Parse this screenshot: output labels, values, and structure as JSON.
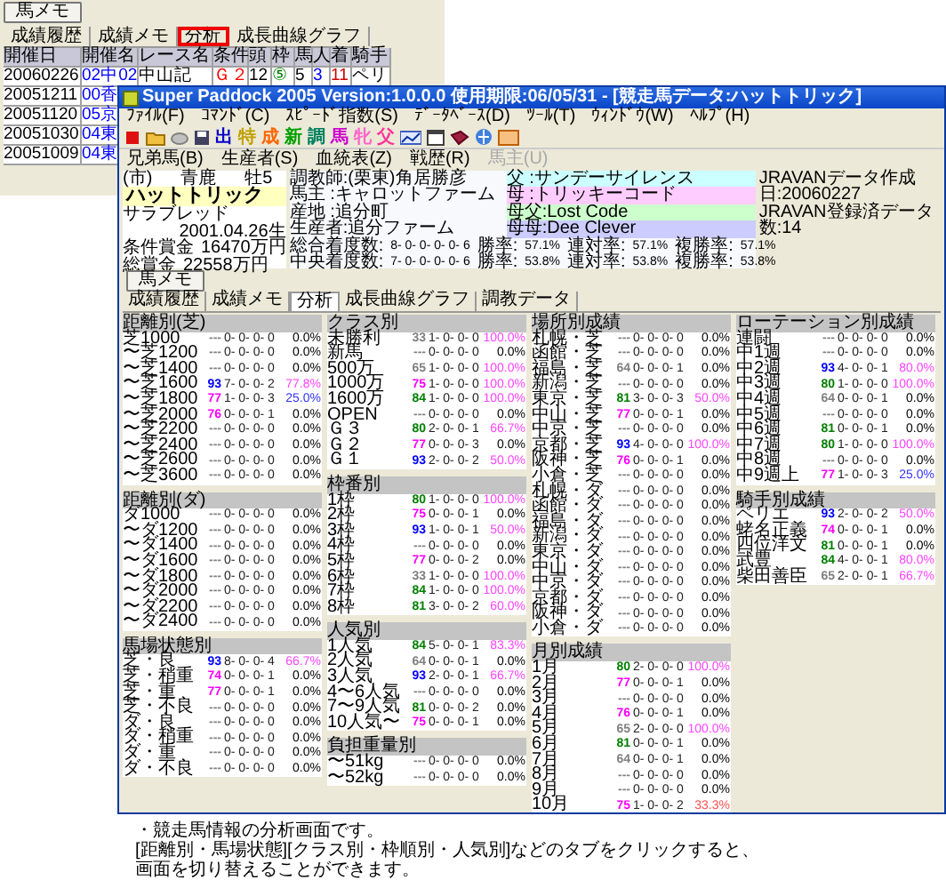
{
  "back_window": {
    "memo_button": "馬メモ",
    "tabs": [
      {
        "label": "成績履歴",
        "selected": false
      },
      {
        "label": "成績メモ",
        "selected": false
      },
      {
        "label": "分析",
        "selected": true
      },
      {
        "label": "成長曲線グラフ",
        "selected": false
      }
    ],
    "columns": [
      "開催日",
      "開催名",
      "レース名",
      "条件",
      "頭",
      "枠",
      "馬",
      "人",
      "着",
      "騎手"
    ],
    "rows": [
      {
        "cells": [
          {
            "text": "20060226"
          },
          {
            "text": "02中02",
            "color": "#0000ff"
          },
          {
            "text": "中山記"
          },
          {
            "text": "Ｇ２",
            "color": "#ff0000"
          },
          {
            "text": "12"
          },
          {
            "text": "⑤",
            "color": "#008000"
          },
          {
            "text": "5"
          },
          {
            "text": "3",
            "color": "#0000ff"
          },
          {
            "text": "11",
            "color": "#cc0000"
          },
          {
            "text": "ペリ"
          }
        ]
      },
      {
        "cells": [
          {
            "text": "20051211"
          },
          {
            "text": "00香",
            "color": "#0000ff"
          }
        ]
      },
      {
        "cells": [
          {
            "text": "20051120"
          },
          {
            "text": "05京",
            "color": "#0000ff"
          }
        ]
      },
      {
        "cells": [
          {
            "text": "20051030"
          },
          {
            "text": "04東",
            "color": "#0000ff"
          }
        ]
      },
      {
        "cells": [
          {
            "text": "20051009"
          },
          {
            "text": "04東",
            "color": "#0000ff"
          }
        ]
      }
    ]
  },
  "window": {
    "title": "Super Paddock 2005 Version:1.0.0.0 使用期限:06/05/31 - [競走馬データ:ハットトリック]",
    "menu": [
      "ﾌｧｲﾙ(F)",
      "ｺﾏﾝﾄﾞ(C)",
      "ｽﾋﾟｰﾄﾞ指数(S)",
      "ﾃﾞｰﾀﾍﾞｰｽ(D)",
      "ﾂｰﾙ(T)",
      "ｳｨﾝﾄﾞｳ(W)",
      "ﾍﾙﾌﾟ(H)"
    ],
    "toolbar_chars": [
      {
        "text": "出",
        "color": "#0000cc"
      },
      {
        "text": "特",
        "color": "#c0a000"
      },
      {
        "text": "成",
        "color": "#ff6600"
      },
      {
        "text": "新",
        "color": "#00a000"
      },
      {
        "text": "調",
        "color": "#008060"
      },
      {
        "text": "馬",
        "color": "#cc00cc"
      },
      {
        "text": "牝",
        "color": "#ff66cc"
      },
      {
        "text": "父",
        "color": "#ff3399"
      }
    ],
    "toolbar2": [
      {
        "label": "兄弟馬(B)",
        "disabled": false
      },
      {
        "label": "生産者(S)",
        "disabled": false
      },
      {
        "label": "血統表(Z)",
        "disabled": false
      },
      {
        "label": "戦歴(R)",
        "disabled": false
      },
      {
        "label": "馬主(U)",
        "disabled": true
      }
    ]
  },
  "horse": {
    "region": "(市)",
    "coat": "青鹿",
    "sex_age": "牡5",
    "name": "ハットトリック",
    "breed": "サラブレッド",
    "birth": "2001.04.26生",
    "prizes": [
      {
        "label": "条件賞金",
        "value": "16470万円"
      },
      {
        "label": "総賞金",
        "value": "22558万円"
      }
    ],
    "details": [
      "調教師:(栗東)角居勝彦",
      "馬主 :キャロットファーム",
      "産地 :追分町",
      "生産者:追分ファーム"
    ],
    "pedigree": [
      {
        "text": "父 :サンデーサイレンス",
        "color": "#ccffff"
      },
      {
        "text": "母 :トリッキーコード",
        "color": "#ffccff"
      },
      {
        "text": "母父:Lost Code",
        "color": "#ccffcc"
      },
      {
        "text": "母母:Dee Clever",
        "color": "#ccccff"
      }
    ],
    "records": [
      {
        "label": "総合着度数:",
        "counts": "8- 0- 0- 0- 0- 6",
        "stats": [
          {
            "label": "勝率:",
            "value": "57.1%"
          },
          {
            "label": "連対率:",
            "value": "57.1%"
          },
          {
            "label": "複勝率:",
            "value": "57.1%"
          }
        ]
      },
      {
        "label": "中央着度数:",
        "counts": "7- 0- 0- 0- 0- 6",
        "stats": [
          {
            "label": "勝率:",
            "value": "53.8%"
          },
          {
            "label": "連対率:",
            "value": "53.8%"
          },
          {
            "label": "複勝率:",
            "value": "53.8%"
          }
        ]
      }
    ],
    "jravan": [
      "JRAVANデータ作成日:20060227",
      "JRAVAN登録済データ数:14"
    ]
  },
  "memo_button": "馬メモ",
  "tabs": [
    {
      "label": "成績履歴",
      "selected": false
    },
    {
      "label": "成績メモ",
      "selected": false
    },
    {
      "label": "分析",
      "selected": true
    },
    {
      "label": "成長曲線グラフ",
      "selected": false
    },
    {
      "label": "調教データ",
      "selected": false
    }
  ],
  "columns": [
    {
      "sections": [
        {
          "title": "距離別(芝)",
          "rows": [
            {
              "label": "芝1000",
              "index": "---",
              "color": "#808080",
              "record": "0- 0- 0- 0",
              "rate": {
                "text": "0.0%"
              }
            },
            {
              "label": "〜芝1200",
              "index": "---",
              "color": "#808080",
              "record": "0- 0- 0- 0",
              "rate": {
                "text": "0.0%"
              }
            },
            {
              "label": "〜芝1400",
              "index": "---",
              "color": "#808080",
              "record": "0- 0- 0- 0",
              "rate": {
                "text": "0.0%"
              }
            },
            {
              "label": "〜芝1600",
              "index": "93",
              "color": "#0000ff",
              "record": "7- 0- 0- 2",
              "rate": {
                "text": "77.8%",
                "color": "#ff44ff"
              }
            },
            {
              "label": "〜芝1800",
              "index": "77",
              "color": "#ff00ff",
              "record": "1- 0- 0- 3",
              "rate": {
                "text": "25.0%",
                "color": "#3333ff"
              }
            },
            {
              "label": "〜芝2000",
              "index": "76",
              "color": "#ff00ff",
              "record": "0- 0- 0- 1",
              "rate": {
                "text": "0.0%"
              }
            },
            {
              "label": "〜芝2200",
              "index": "---",
              "color": "#808080",
              "record": "0- 0- 0- 0",
              "rate": {
                "text": "0.0%"
              }
            },
            {
              "label": "〜芝2400",
              "index": "---",
              "color": "#808080",
              "record": "0- 0- 0- 0",
              "rate": {
                "text": "0.0%"
              }
            },
            {
              "label": "〜芝2600",
              "index": "---",
              "color": "#808080",
              "record": "0- 0- 0- 0",
              "rate": {
                "text": "0.0%"
              }
            },
            {
              "label": "〜芝3600",
              "index": "---",
              "color": "#808080",
              "record": "0- 0- 0- 0",
              "rate": {
                "text": "0.0%"
              }
            }
          ]
        },
        {
          "title": "距離別(ダ)",
          "rows": [
            {
              "label": "ダ1000",
              "index": "---",
              "color": "#808080",
              "record": "0- 0- 0- 0",
              "rate": {
                "text": "0.0%"
              }
            },
            {
              "label": "〜ダ1200",
              "index": "---",
              "color": "#808080",
              "record": "0- 0- 0- 0",
              "rate": {
                "text": "0.0%"
              }
            },
            {
              "label": "〜ダ1400",
              "index": "---",
              "color": "#808080",
              "record": "0- 0- 0- 0",
              "rate": {
                "text": "0.0%"
              }
            },
            {
              "label": "〜ダ1600",
              "index": "---",
              "color": "#808080",
              "record": "0- 0- 0- 0",
              "rate": {
                "text": "0.0%"
              }
            },
            {
              "label": "〜ダ1800",
              "index": "---",
              "color": "#808080",
              "record": "0- 0- 0- 0",
              "rate": {
                "text": "0.0%"
              }
            },
            {
              "label": "〜ダ2000",
              "index": "---",
              "color": "#808080",
              "record": "0- 0- 0- 0",
              "rate": {
                "text": "0.0%"
              }
            },
            {
              "label": "〜ダ2200",
              "index": "---",
              "color": "#808080",
              "record": "0- 0- 0- 0",
              "rate": {
                "text": "0.0%"
              }
            },
            {
              "label": "〜ダ2400",
              "index": "---",
              "color": "#808080",
              "record": "0- 0- 0- 0",
              "rate": {
                "text": "0.0%"
              }
            }
          ]
        },
        {
          "title": "馬場状態別",
          "rows": [
            {
              "label": "芝・良",
              "index": "93",
              "color": "#0000ff",
              "record": "8- 0- 0- 4",
              "rate": {
                "text": "66.7%",
                "color": "#ff44ff"
              }
            },
            {
              "label": "芝・稍重",
              "index": "74",
              "color": "#ff00ff",
              "record": "0- 0- 0- 1",
              "rate": {
                "text": "0.0%"
              }
            },
            {
              "label": "芝・重",
              "index": "77",
              "color": "#ff00ff",
              "record": "0- 0- 0- 1",
              "rate": {
                "text": "0.0%"
              }
            },
            {
              "label": "芝・不良",
              "index": "---",
              "color": "#808080",
              "record": "0- 0- 0- 0",
              "rate": {
                "text": "0.0%"
              }
            },
            {
              "label": "ダ・良",
              "index": "---",
              "color": "#808080",
              "record": "0- 0- 0- 0",
              "rate": {
                "text": "0.0%"
              }
            },
            {
              "label": "ダ・稍重",
              "index": "---",
              "color": "#808080",
              "record": "0- 0- 0- 0",
              "rate": {
                "text": "0.0%"
              }
            },
            {
              "label": "ダ・重",
              "index": "---",
              "color": "#808080",
              "record": "0- 0- 0- 0",
              "rate": {
                "text": "0.0%"
              }
            },
            {
              "label": "ダ・不良",
              "index": "---",
              "color": "#808080",
              "record": "0- 0- 0- 0",
              "rate": {
                "text": "0.0%"
              }
            }
          ]
        }
      ]
    },
    {
      "sections": [
        {
          "title": "クラス別",
          "rows": [
            {
              "label": "未勝利",
              "index": "33",
              "color": "#808080",
              "record": "1- 0- 0- 0",
              "rate": {
                "text": "100.0%",
                "color": "#ff44ff"
              }
            },
            {
              "label": "新馬",
              "index": "---",
              "color": "#808080",
              "record": "0- 0- 0- 0",
              "rate": {
                "text": "0.0%"
              }
            },
            {
              "label": "500万",
              "index": "65",
              "color": "#808080",
              "record": "1- 0- 0- 0",
              "rate": {
                "text": "100.0%",
                "color": "#ff44ff"
              }
            },
            {
              "label": "1000万",
              "index": "75",
              "color": "#ff00ff",
              "record": "1- 0- 0- 0",
              "rate": {
                "text": "100.0%",
                "color": "#ff44ff"
              }
            },
            {
              "label": "1600万",
              "index": "84",
              "color": "#008000",
              "record": "1- 0- 0- 0",
              "rate": {
                "text": "100.0%",
                "color": "#ff44ff"
              }
            },
            {
              "label": "OPEN",
              "index": "---",
              "color": "#808080",
              "record": "0- 0- 0- 0",
              "rate": {
                "text": "0.0%"
              }
            },
            {
              "label": "Ｇ３",
              "index": "80",
              "color": "#008000",
              "record": "2- 0- 0- 1",
              "rate": {
                "text": "66.7%",
                "color": "#ff44ff"
              }
            },
            {
              "label": "Ｇ２",
              "index": "77",
              "color": "#ff00ff",
              "record": "0- 0- 0- 3",
              "rate": {
                "text": "0.0%"
              }
            },
            {
              "label": "Ｇ１",
              "index": "93",
              "color": "#0000ff",
              "record": "2- 0- 0- 2",
              "rate": {
                "text": "50.0%",
                "color": "#ff44ff"
              }
            }
          ]
        },
        {
          "title": "枠番別",
          "rows": [
            {
              "label": "1枠",
              "index": "80",
              "color": "#008000",
              "record": "1- 0- 0- 0",
              "rate": {
                "text": "100.0%",
                "color": "#ff44ff"
              }
            },
            {
              "label": "2枠",
              "index": "75",
              "color": "#ff00ff",
              "record": "0- 0- 0- 1",
              "rate": {
                "text": "0.0%"
              }
            },
            {
              "label": "3枠",
              "index": "93",
              "color": "#0000ff",
              "record": "1- 0- 0- 1",
              "rate": {
                "text": "50.0%",
                "color": "#ff44ff"
              }
            },
            {
              "label": "4枠",
              "index": "---",
              "color": "#808080",
              "record": "0- 0- 0- 0",
              "rate": {
                "text": "0.0%"
              }
            },
            {
              "label": "5枠",
              "index": "77",
              "color": "#ff00ff",
              "record": "0- 0- 0- 2",
              "rate": {
                "text": "0.0%"
              }
            },
            {
              "label": "6枠",
              "index": "33",
              "color": "#808080",
              "record": "1- 0- 0- 0",
              "rate": {
                "text": "100.0%",
                "color": "#ff44ff"
              }
            },
            {
              "label": "7枠",
              "index": "84",
              "color": "#008000",
              "record": "1- 0- 0- 0",
              "rate": {
                "text": "100.0%",
                "color": "#ff44ff"
              }
            },
            {
              "label": "8枠",
              "index": "81",
              "color": "#008000",
              "record": "3- 0- 0- 2",
              "rate": {
                "text": "60.0%",
                "color": "#ff44ff"
              }
            }
          ]
        },
        {
          "title": "人気別",
          "rows": [
            {
              "label": "1人気",
              "index": "84",
              "color": "#008000",
              "record": "5- 0- 0- 1",
              "rate": {
                "text": "83.3%",
                "color": "#ff44ff"
              }
            },
            {
              "label": "2人気",
              "index": "64",
              "color": "#808080",
              "record": "0- 0- 0- 1",
              "rate": {
                "text": "0.0%"
              }
            },
            {
              "label": "3人気",
              "index": "93",
              "color": "#0000ff",
              "record": "2- 0- 0- 1",
              "rate": {
                "text": "66.7%",
                "color": "#ff44ff"
              }
            },
            {
              "label": "4〜6人気",
              "index": "---",
              "color": "#808080",
              "record": "0- 0- 0- 0",
              "rate": {
                "text": "0.0%"
              }
            },
            {
              "label": "7〜9人気",
              "index": "81",
              "color": "#008000",
              "record": "0- 0- 0- 2",
              "rate": {
                "text": "0.0%"
              }
            },
            {
              "label": "10人気〜",
              "index": "75",
              "color": "#ff00ff",
              "record": "0- 0- 0- 1",
              "rate": {
                "text": "0.0%"
              }
            }
          ]
        },
        {
          "title": "負担重量別",
          "rows": [
            {
              "label": "〜51kg",
              "index": "---",
              "color": "#808080",
              "record": "0- 0- 0- 0",
              "rate": {
                "text": "0.0%"
              }
            },
            {
              "label": "〜52kg",
              "index": "---",
              "color": "#808080",
              "record": "0- 0- 0- 0",
              "rate": {
                "text": "0.0%"
              }
            }
          ]
        }
      ]
    },
    {
      "sections": [
        {
          "title": "場所別成績",
          "rows": [
            {
              "label": "札幌・芝",
              "index": "---",
              "color": "#808080",
              "record": "0- 0- 0- 0",
              "rate": {
                "text": "0.0%"
              }
            },
            {
              "label": "函館・芝",
              "index": "---",
              "color": "#808080",
              "record": "0- 0- 0- 0",
              "rate": {
                "text": "0.0%"
              }
            },
            {
              "label": "福島・芝",
              "index": "64",
              "color": "#808080",
              "record": "0- 0- 0- 1",
              "rate": {
                "text": "0.0%"
              }
            },
            {
              "label": "新潟・芝",
              "index": "---",
              "color": "#808080",
              "record": "0- 0- 0- 0",
              "rate": {
                "text": "0.0%"
              }
            },
            {
              "label": "東京・芝",
              "index": "81",
              "color": "#008000",
              "record": "3- 0- 0- 3",
              "rate": {
                "text": "50.0%",
                "color": "#ff44ff"
              }
            },
            {
              "label": "中山・芝",
              "index": "77",
              "color": "#ff00ff",
              "record": "0- 0- 0- 1",
              "rate": {
                "text": "0.0%"
              }
            },
            {
              "label": "中京・芝",
              "index": "---",
              "color": "#808080",
              "record": "0- 0- 0- 0",
              "rate": {
                "text": "0.0%"
              }
            },
            {
              "label": "京都・芝",
              "index": "93",
              "color": "#0000ff",
              "record": "4- 0- 0- 0",
              "rate": {
                "text": "100.0%",
                "color": "#ff44ff"
              }
            },
            {
              "label": "阪神・芝",
              "index": "76",
              "color": "#ff00ff",
              "record": "0- 0- 0- 1",
              "rate": {
                "text": "0.0%"
              }
            },
            {
              "label": "小倉・芝",
              "index": "---",
              "color": "#808080",
              "record": "0- 0- 0- 0",
              "rate": {
                "text": "0.0%"
              }
            },
            {
              "label": "札幌・ダ",
              "index": "---",
              "color": "#808080",
              "record": "0- 0- 0- 0",
              "rate": {
                "text": "0.0%"
              }
            },
            {
              "label": "函館・ダ",
              "index": "---",
              "color": "#808080",
              "record": "0- 0- 0- 0",
              "rate": {
                "text": "0.0%"
              }
            },
            {
              "label": "福島・ダ",
              "index": "---",
              "color": "#808080",
              "record": "0- 0- 0- 0",
              "rate": {
                "text": "0.0%"
              }
            },
            {
              "label": "新潟・ダ",
              "index": "---",
              "color": "#808080",
              "record": "0- 0- 0- 0",
              "rate": {
                "text": "0.0%"
              }
            },
            {
              "label": "東京・ダ",
              "index": "---",
              "color": "#808080",
              "record": "0- 0- 0- 0",
              "rate": {
                "text": "0.0%"
              }
            },
            {
              "label": "中山・ダ",
              "index": "---",
              "color": "#808080",
              "record": "0- 0- 0- 0",
              "rate": {
                "text": "0.0%"
              }
            },
            {
              "label": "中京・ダ",
              "index": "---",
              "color": "#808080",
              "record": "0- 0- 0- 0",
              "rate": {
                "text": "0.0%"
              }
            },
            {
              "label": "京都・ダ",
              "index": "---",
              "color": "#808080",
              "record": "0- 0- 0- 0",
              "rate": {
                "text": "0.0%"
              }
            },
            {
              "label": "阪神・ダ",
              "index": "---",
              "color": "#808080",
              "record": "0- 0- 0- 0",
              "rate": {
                "text": "0.0%"
              }
            },
            {
              "label": "小倉・ダ",
              "index": "---",
              "color": "#808080",
              "record": "0- 0- 0- 0",
              "rate": {
                "text": "0.0%"
              }
            }
          ]
        },
        {
          "title": "月別成績",
          "rows": [
            {
              "label": "1月",
              "index": "80",
              "color": "#008000",
              "record": "2- 0- 0- 0",
              "rate": {
                "text": "100.0%",
                "color": "#ff44ff"
              }
            },
            {
              "label": "2月",
              "index": "77",
              "color": "#ff00ff",
              "record": "0- 0- 0- 1",
              "rate": {
                "text": "0.0%"
              }
            },
            {
              "label": "3月",
              "index": "---",
              "color": "#808080",
              "record": "0- 0- 0- 0",
              "rate": {
                "text": "0.0%"
              }
            },
            {
              "label": "4月",
              "index": "76",
              "color": "#ff00ff",
              "record": "0- 0- 0- 1",
              "rate": {
                "text": "0.0%"
              }
            },
            {
              "label": "5月",
              "index": "65",
              "color": "#808080",
              "record": "2- 0- 0- 0",
              "rate": {
                "text": "100.0%",
                "color": "#ff44ff"
              }
            },
            {
              "label": "6月",
              "index": "81",
              "color": "#008000",
              "record": "0- 0- 0- 1",
              "rate": {
                "text": "0.0%"
              }
            },
            {
              "label": "7月",
              "index": "64",
              "color": "#808080",
              "record": "0- 0- 0- 1",
              "rate": {
                "text": "0.0%"
              }
            },
            {
              "label": "8月",
              "index": "---",
              "color": "#808080",
              "record": "0- 0- 0- 0",
              "rate": {
                "text": "0.0%"
              }
            },
            {
              "label": "9月",
              "index": "---",
              "color": "#808080",
              "record": "0- 0- 0- 0",
              "rate": {
                "text": "0.0%"
              }
            },
            {
              "label": "10月",
              "index": "75",
              "color": "#ff00ff",
              "record": "1- 0- 0- 2",
              "rate": {
                "text": "33.3%",
                "color": "#ff5050"
              }
            }
          ]
        }
      ]
    },
    {
      "sections": [
        {
          "title": "ローテーション別成績",
          "rows": [
            {
              "label": "連闘",
              "index": "---",
              "color": "#808080",
              "record": "0- 0- 0- 0",
              "rate": {
                "text": "0.0%"
              }
            },
            {
              "label": "中1週",
              "index": "---",
              "color": "#808080",
              "record": "0- 0- 0- 0",
              "rate": {
                "text": "0.0%"
              }
            },
            {
              "label": "中2週",
              "index": "93",
              "color": "#0000ff",
              "record": "4- 0- 0- 1",
              "rate": {
                "text": "80.0%",
                "color": "#ff44ff"
              }
            },
            {
              "label": "中3週",
              "index": "80",
              "color": "#008000",
              "record": "1- 0- 0- 0",
              "rate": {
                "text": "100.0%",
                "color": "#ff44ff"
              }
            },
            {
              "label": "中4週",
              "index": "64",
              "color": "#808080",
              "record": "0- 0- 0- 1",
              "rate": {
                "text": "0.0%"
              }
            },
            {
              "label": "中5週",
              "index": "---",
              "color": "#808080",
              "record": "0- 0- 0- 0",
              "rate": {
                "text": "0.0%"
              }
            },
            {
              "label": "中6週",
              "index": "81",
              "color": "#008000",
              "record": "0- 0- 0- 1",
              "rate": {
                "text": "0.0%"
              }
            },
            {
              "label": "中7週",
              "index": "80",
              "color": "#008000",
              "record": "1- 0- 0- 0",
              "rate": {
                "text": "100.0%",
                "color": "#ff44ff"
              }
            },
            {
              "label": "中8週",
              "index": "---",
              "color": "#808080",
              "record": "0- 0- 0- 0",
              "rate": {
                "text": "0.0%"
              }
            },
            {
              "label": "中9週上",
              "index": "77",
              "color": "#ff00ff",
              "record": "1- 0- 0- 3",
              "rate": {
                "text": "25.0%",
                "color": "#3333ff"
              }
            }
          ]
        },
        {
          "title": "騎手別成績",
          "rows": [
            {
              "label": "ペリエ",
              "index": "93",
              "color": "#0000ff",
              "record": "2- 0- 0- 2",
              "rate": {
                "text": "50.0%",
                "color": "#ff44ff"
              }
            },
            {
              "label": "蛯名正義",
              "index": "74",
              "color": "#ff00ff",
              "record": "0- 0- 0- 1",
              "rate": {
                "text": "0.0%"
              }
            },
            {
              "label": "四位洋文",
              "index": "81",
              "color": "#008000",
              "record": "0- 0- 0- 1",
              "rate": {
                "text": "0.0%"
              }
            },
            {
              "label": "武豊",
              "index": "84",
              "color": "#008000",
              "record": "4- 0- 0- 1",
              "rate": {
                "text": "80.0%",
                "color": "#ff44ff"
              }
            },
            {
              "label": "柴田善臣",
              "index": "65",
              "color": "#808080",
              "record": "2- 0- 0- 1",
              "rate": {
                "text": "66.7%",
                "color": "#ff44ff"
              }
            }
          ]
        }
      ]
    }
  ],
  "caption": [
    "・競走馬情報の分析画面です。",
    "[距離別・馬場状態][クラス別・枠順別・人気別]などのタブをクリックすると、",
    "画面を切り替えることができます。"
  ]
}
